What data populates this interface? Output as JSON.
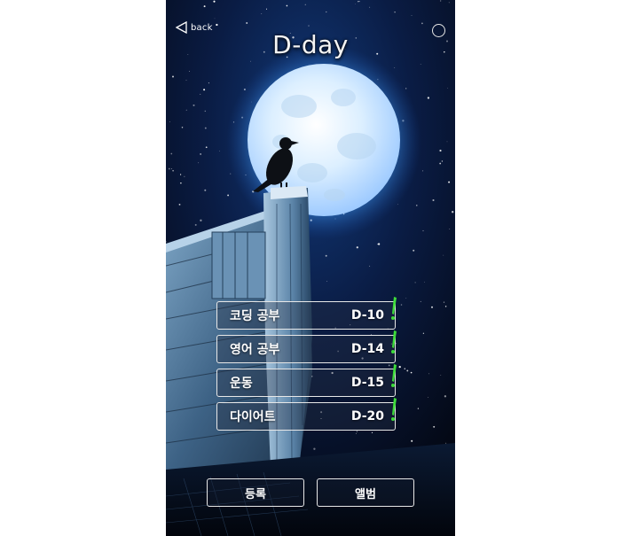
{
  "header": {
    "back_label": "back",
    "title": "D-day",
    "back_icon": "back-triangle-icon",
    "settings_icon": "settings-circle-icon"
  },
  "dday_items": [
    {
      "name": "코딩 공부",
      "count": "D-10"
    },
    {
      "name": "영어 공부",
      "count": "D-14"
    },
    {
      "name": "운동",
      "count": "D-15"
    },
    {
      "name": "다이어트",
      "count": "D-20"
    }
  ],
  "buttons": {
    "register": "등록",
    "album": "앨범"
  },
  "colors": {
    "flag_accent": "#3ddc3a",
    "border": "#e8e8e8",
    "moon_glow": "#6fb6ff",
    "sky": "#050a1c"
  }
}
